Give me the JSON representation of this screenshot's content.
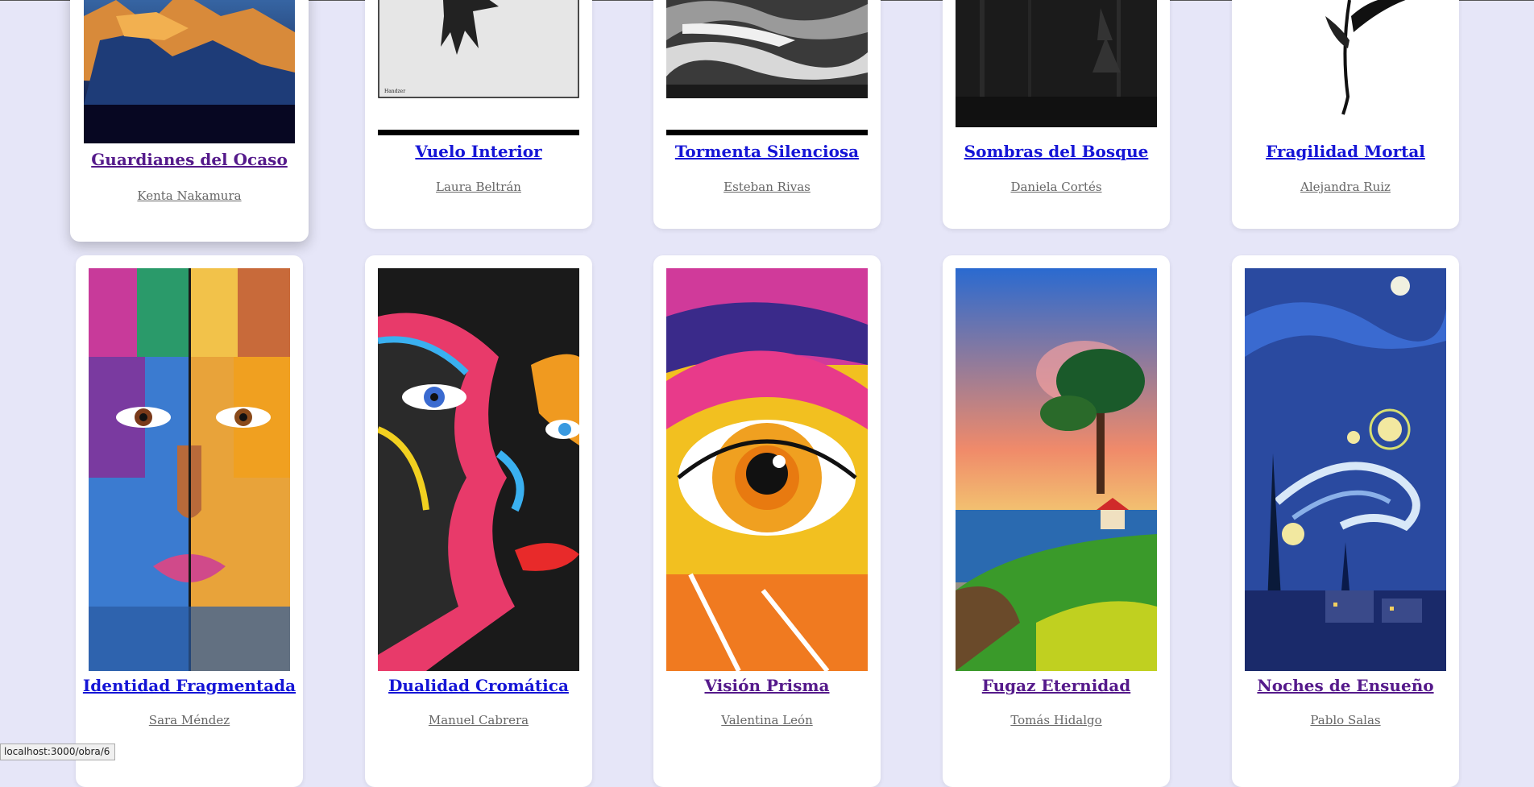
{
  "cards": [
    {
      "title": "Guardianes del Ocaso",
      "artist": "Kenta Nakamura",
      "image": "sunset-cliff-landscape"
    },
    {
      "title": "Vuelo Interior",
      "artist": "Laura Beltrán",
      "image": "black-white-abstract-bird"
    },
    {
      "title": "Tormenta Silenciosa",
      "artist": "Esteban Rivas",
      "image": "grayscale-storm-abstract"
    },
    {
      "title": "Sombras del Bosque",
      "artist": "Daniela Cortés",
      "image": "dark-forest"
    },
    {
      "title": "Fragilidad Mortal",
      "artist": "Alejandra Ruiz",
      "image": "ink-stem-drawing"
    },
    {
      "title": "Identidad Fragmentada",
      "artist": "Sara Méndez",
      "image": "fragmented-face-portrait"
    },
    {
      "title": "Dualidad Cromática",
      "artist": "Manuel Cabrera",
      "image": "colorful-face-portrait"
    },
    {
      "title": "Visión Prisma",
      "artist": "Valentina León",
      "image": "colorful-eye"
    },
    {
      "title": "Fugaz Eternidad",
      "artist": "Tomás Hidalgo",
      "image": "seaside-cliff-house"
    },
    {
      "title": "Noches de Ensueño",
      "artist": "Pablo Salas",
      "image": "starry-night-village"
    }
  ],
  "status_bar": {
    "url": "localhost:3000/obra/6"
  },
  "colors": {
    "background": "#e6e6f8",
    "link": "#1515d6",
    "visited": "#551a8b",
    "artist": "#666666"
  }
}
